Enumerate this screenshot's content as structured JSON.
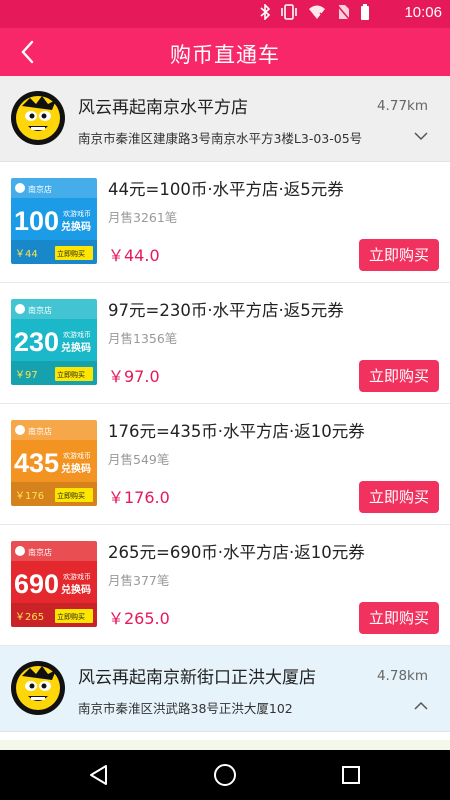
{
  "status": {
    "time": "10:06",
    "icons": [
      "bluetooth-icon",
      "vibrate-icon",
      "wifi-icon",
      "no-sim-icon",
      "battery-icon"
    ]
  },
  "header": {
    "title": "购币直通车",
    "back_icon": "back-arrow-icon"
  },
  "stores": [
    {
      "name": "风云再起南京水平方店",
      "address": "南京市秦淮区建康路3号南京水平方3楼L3-03-05号",
      "distance": "4.77km",
      "chevron": "chevron-down-icon"
    },
    {
      "name": "风云再起南京新街口正洪大厦店",
      "address": "南京市秦淮区洪武路38号正洪大厦102",
      "distance": "4.78km",
      "chevron": "chevron-up-icon"
    }
  ],
  "products": [
    {
      "title": "44元=100币·水平方店·返5元券",
      "sales": "月售3261笔",
      "price": "￥44.0",
      "buy_label": "立即购买",
      "thumb": {
        "coins": "100",
        "price": "￥44",
        "color": "#1c9be6",
        "tag": "南京店",
        "line1": "欢游戏币",
        "line2": "兑换码",
        "btn": "立即购买"
      }
    },
    {
      "title": "97元=230币·水平方店·返5元券",
      "sales": "月售1356笔",
      "price": "￥97.0",
      "buy_label": "立即购买",
      "thumb": {
        "coins": "230",
        "price": "￥97",
        "color": "#1ab8c8",
        "tag": "南京店",
        "line1": "欢游戏币",
        "line2": "兑换码",
        "btn": "立即购买"
      }
    },
    {
      "title": "176元=435币·水平方店·返10元券",
      "sales": "月售549笔",
      "price": "￥176.0",
      "buy_label": "立即购买",
      "thumb": {
        "coins": "435",
        "price": "￥176",
        "color": "#f39422",
        "tag": "南京店",
        "line1": "欢游戏币",
        "line2": "兑换码",
        "btn": "立即购买"
      }
    },
    {
      "title": "265元=690币·水平方店·返10元券",
      "sales": "月售377笔",
      "price": "￥265.0",
      "buy_label": "立即购买",
      "thumb": {
        "coins": "690",
        "price": "￥265",
        "color": "#e5282d",
        "tag": "南京店",
        "line1": "欢游戏币",
        "line2": "兑换码",
        "btn": "立即购买"
      }
    }
  ],
  "system_nav": {
    "back": "back-triangle-icon",
    "home": "home-circle-icon",
    "recents": "recents-square-icon"
  },
  "colors": {
    "accent": "#f7276a",
    "status": "#e6195a",
    "price": "#e6195a",
    "button": "#f2325e"
  }
}
